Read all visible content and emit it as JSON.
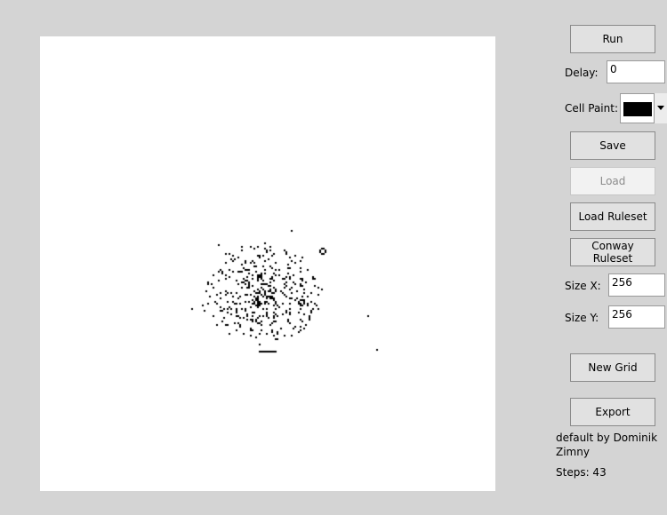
{
  "controls": {
    "run_label": "Run",
    "delay_label": "Delay:",
    "delay_value": "0",
    "cell_paint_label": "Cell Paint:",
    "cell_paint_color": "#000000",
    "save_label": "Save",
    "load_label": "Load",
    "load_ruleset_label": "Load Ruleset",
    "conway_ruleset_label": "Conway Ruleset",
    "size_x_label": "Size X:",
    "size_x_value": "256",
    "size_y_label": "Size Y:",
    "size_y_value": "256",
    "new_grid_label": "New Grid",
    "export_label": "Export"
  },
  "info": {
    "ruleset_credit": "default by Dominik Zimny",
    "steps_text": "Steps: 43"
  },
  "grid": {
    "background_color": "#ffffff",
    "live_cell_color": "#000000"
  }
}
